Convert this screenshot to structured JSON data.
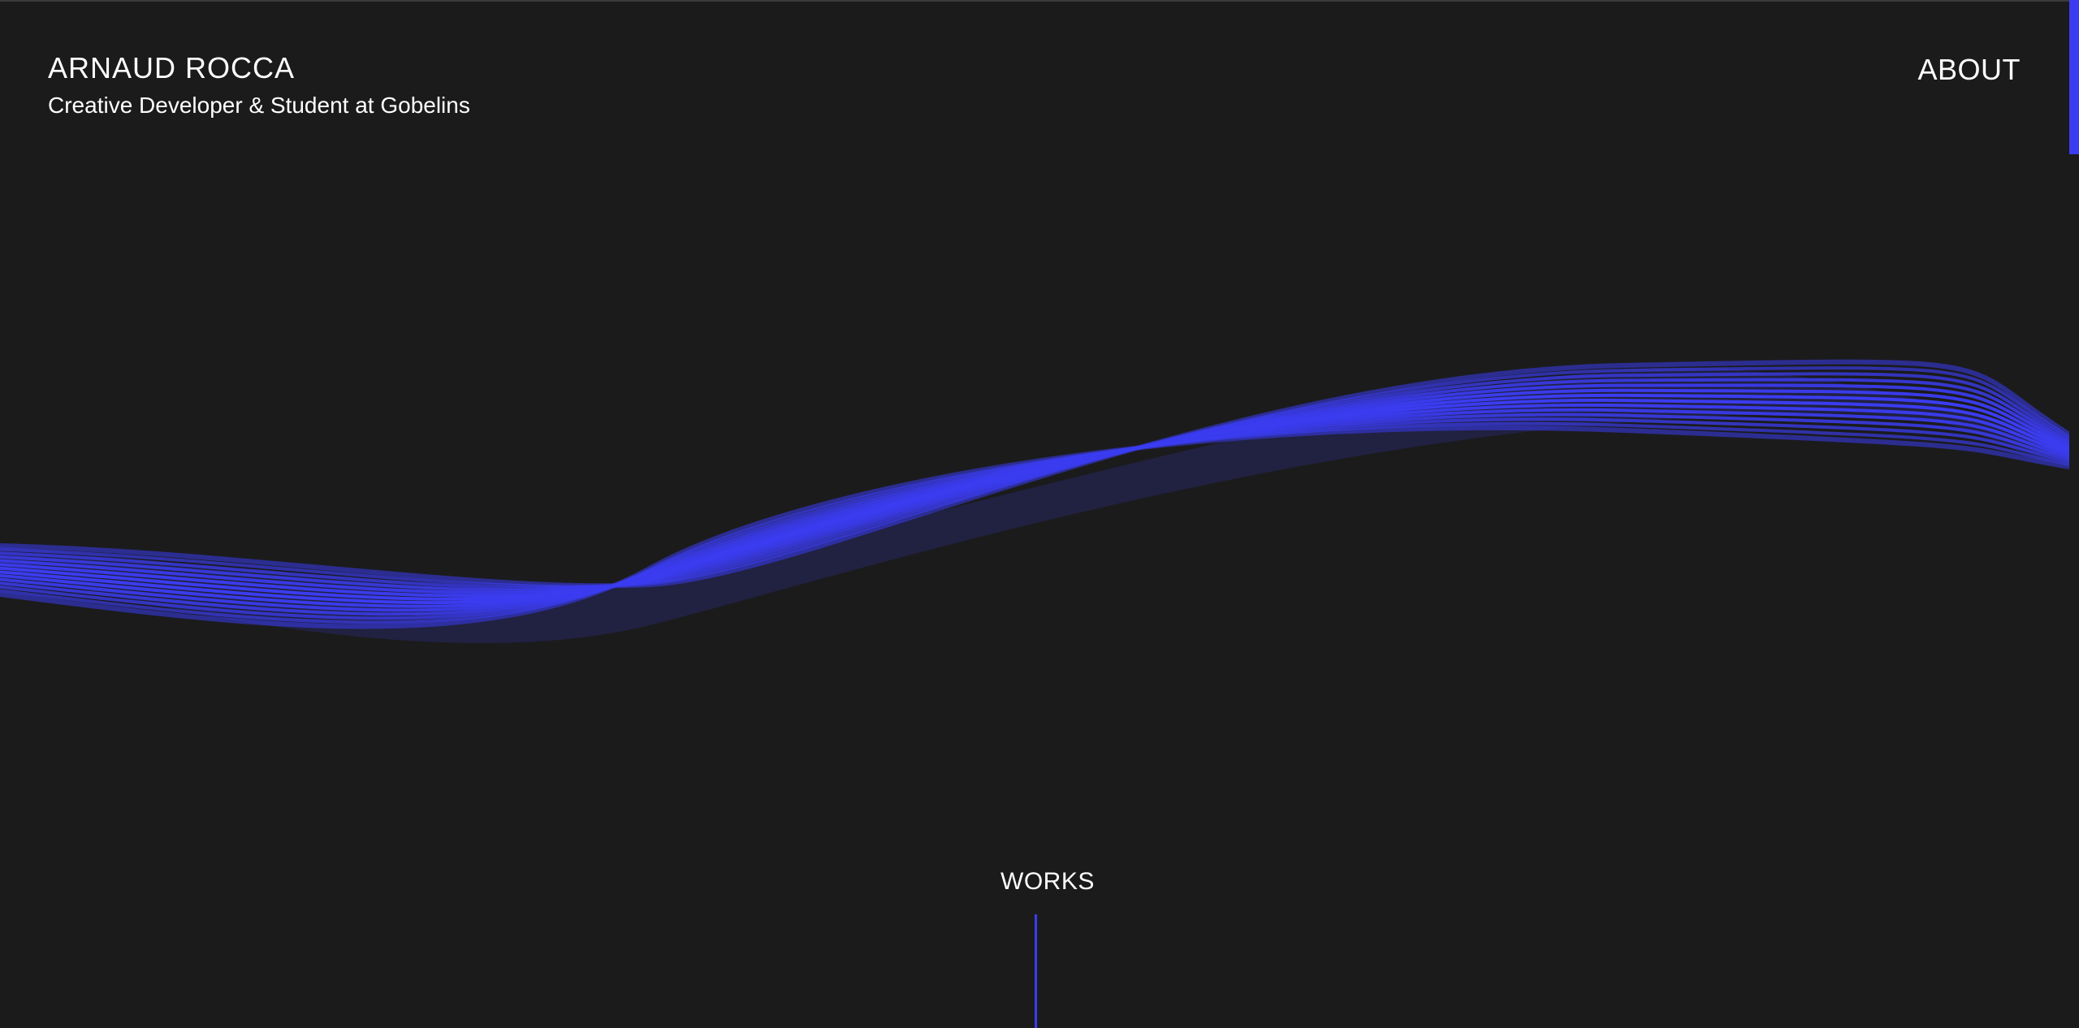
{
  "header": {
    "name": "ARNAUD ROCCA",
    "tagline": "Creative Developer & Student at Gobelins"
  },
  "nav": {
    "about_label": "ABOUT"
  },
  "works": {
    "label": "WORKS"
  },
  "colors": {
    "background": "#1b1b1c",
    "accent": "#3b3cf0",
    "text": "#ffffff"
  },
  "scroll": {
    "position_fraction": 0.0
  }
}
